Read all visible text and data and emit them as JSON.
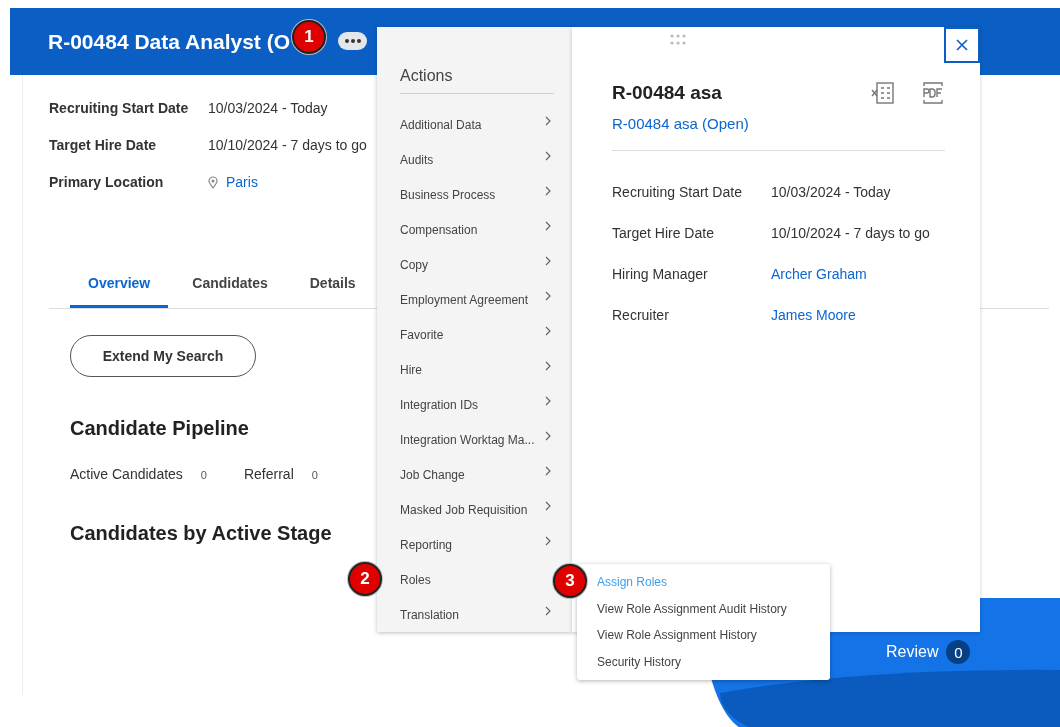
{
  "header": {
    "title": "R-00484 Data Analyst (O"
  },
  "fields": [
    {
      "label": "Recruiting Start Date",
      "value": "10/03/2024 - Today",
      "kind": "text"
    },
    {
      "label": "Target Hire Date",
      "value": "10/10/2024 - 7 days to go",
      "kind": "text"
    },
    {
      "label": "Primary Location",
      "value": "Paris",
      "kind": "location"
    }
  ],
  "tabs": [
    {
      "label": "Overview",
      "selected": true
    },
    {
      "label": "Candidates",
      "selected": false
    },
    {
      "label": "Details",
      "selected": false
    }
  ],
  "extend_button": "Extend My Search",
  "pipeline": {
    "title": "Candidate Pipeline",
    "stats": [
      {
        "label": "Active Candidates",
        "count": "0"
      },
      {
        "label": "Referral",
        "count": "0"
      }
    ]
  },
  "stage_section": {
    "title": "Candidates by Active Stage",
    "review_label": "Review",
    "review_count": "0"
  },
  "actions_menu": {
    "title": "Actions",
    "items": [
      {
        "label": "Additional Data",
        "has_submenu": true
      },
      {
        "label": "Audits",
        "has_submenu": true
      },
      {
        "label": "Business Process",
        "has_submenu": true
      },
      {
        "label": "Compensation",
        "has_submenu": true
      },
      {
        "label": "Copy",
        "has_submenu": true
      },
      {
        "label": "Employment Agreement",
        "has_submenu": true
      },
      {
        "label": "Favorite",
        "has_submenu": true
      },
      {
        "label": "Hire",
        "has_submenu": true
      },
      {
        "label": "Integration IDs",
        "has_submenu": true
      },
      {
        "label": "Integration Worktag Ma...",
        "has_submenu": true
      },
      {
        "label": "Job Change",
        "has_submenu": true
      },
      {
        "label": "Masked Job Requisition",
        "has_submenu": true
      },
      {
        "label": "Reporting",
        "has_submenu": true
      },
      {
        "label": "Roles",
        "has_submenu": false
      },
      {
        "label": "Translation",
        "has_submenu": true
      }
    ]
  },
  "submenu": {
    "items": [
      {
        "label": "Assign Roles",
        "selected": true
      },
      {
        "label": "View Role Assignment Audit History",
        "selected": false
      },
      {
        "label": "View Role Assignment History",
        "selected": false
      },
      {
        "label": "Security History",
        "selected": false
      }
    ]
  },
  "preview": {
    "title": "R-00484 asa",
    "link": "R-00484 asa (Open)",
    "fields": [
      {
        "label": "Recruiting Start Date",
        "value": "10/03/2024 - Today",
        "kind": "text"
      },
      {
        "label": "Target Hire Date",
        "value": "10/10/2024 - 7 days to go",
        "kind": "text"
      },
      {
        "label": "Hiring Manager",
        "value": "Archer Graham",
        "kind": "link"
      },
      {
        "label": "Recruiter",
        "value": "James Moore",
        "kind": "link"
      }
    ]
  },
  "step_badges": [
    {
      "number": "1"
    },
    {
      "number": "2"
    },
    {
      "number": "3"
    }
  ]
}
